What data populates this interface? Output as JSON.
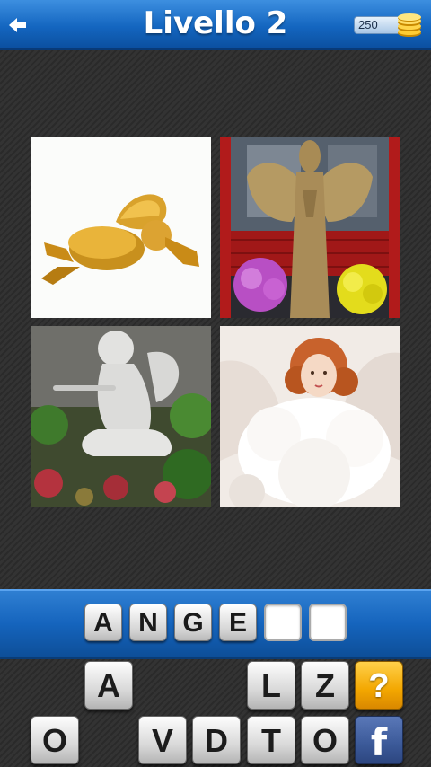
{
  "header": {
    "title": "Livello 2",
    "coins": "250",
    "back_icon": "arrow-left-icon",
    "coins_icon": "gold-coins-icon",
    "accent_color": "#1466c0"
  },
  "pictures": [
    {
      "subject": "golden cherub ornament"
    },
    {
      "subject": "straw angel figure with flowers"
    },
    {
      "subject": "white cherub statue playing flute"
    },
    {
      "subject": "angel doll with white fur"
    }
  ],
  "answer": {
    "slots": [
      "A",
      "N",
      "G",
      "E",
      "",
      ""
    ]
  },
  "keyboard": {
    "row1": [
      "A",
      "L",
      "Z"
    ],
    "row2": [
      "O",
      "V",
      "D",
      "T",
      "O"
    ],
    "hint_label": "?",
    "share_label": "f",
    "hint_color": "#f3a700",
    "share_color": "#3b5998"
  }
}
